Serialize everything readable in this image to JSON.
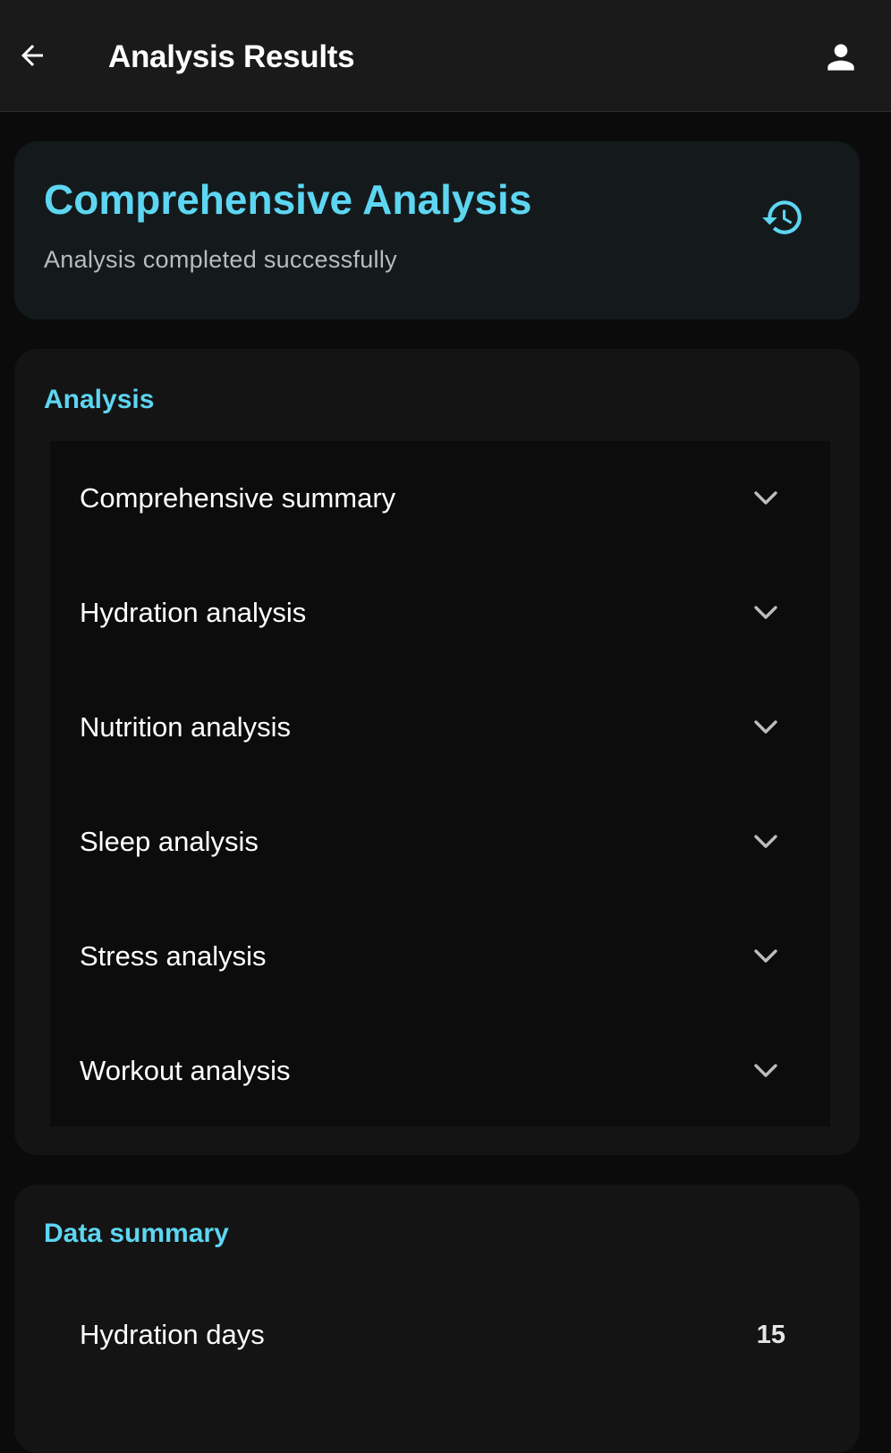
{
  "app_bar": {
    "title": "Analysis Results",
    "back_icon": "arrow-left-icon",
    "profile_icon": "person-icon"
  },
  "hero": {
    "title": "Comprehensive Analysis",
    "subtitle": "Analysis completed successfully",
    "history_icon": "history-icon"
  },
  "analysis_section": {
    "heading": "Analysis",
    "items": [
      {
        "label": "Comprehensive summary",
        "icon": "chevron-down-icon"
      },
      {
        "label": "Hydration analysis",
        "icon": "chevron-down-icon"
      },
      {
        "label": "Nutrition analysis",
        "icon": "chevron-down-icon"
      },
      {
        "label": "Sleep analysis",
        "icon": "chevron-down-icon"
      },
      {
        "label": "Stress analysis",
        "icon": "chevron-down-icon"
      },
      {
        "label": "Workout analysis",
        "icon": "chevron-down-icon"
      }
    ]
  },
  "data_summary": {
    "heading": "Data summary",
    "rows": [
      {
        "label": "Hydration days",
        "value": "15"
      }
    ]
  },
  "colors": {
    "accent": "#5dd6f2",
    "background": "#0b0b0b",
    "app_bar": "#1a1a1b",
    "hero_card": "#141a1c",
    "section_card": "#141414",
    "text_primary": "#ffffff",
    "text_secondary": "#b8bcbe"
  }
}
